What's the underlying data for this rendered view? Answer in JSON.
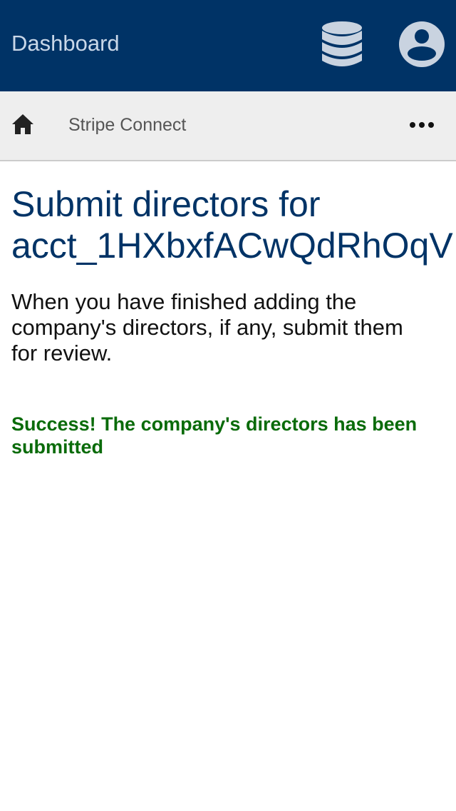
{
  "header": {
    "title": "Dashboard",
    "database_icon": "database-icon",
    "account_icon": "account-circle-icon"
  },
  "breadcrumb": {
    "home_icon": "home-icon",
    "current": "Stripe Connect",
    "more_icon": "more-horizontal-icon"
  },
  "main": {
    "title_line1": "Submit directors for",
    "title_line2": "acct_1HXbxfACwQdRhOqV",
    "description": "When you have finished adding the company's directors, if any, submit them for review.",
    "success_message": "Success! The company's directors has been submitted"
  },
  "colors": {
    "header_bg": "#003366",
    "accent": "#003366",
    "success": "#0a6b0a",
    "icon": "#c9d3e0"
  }
}
